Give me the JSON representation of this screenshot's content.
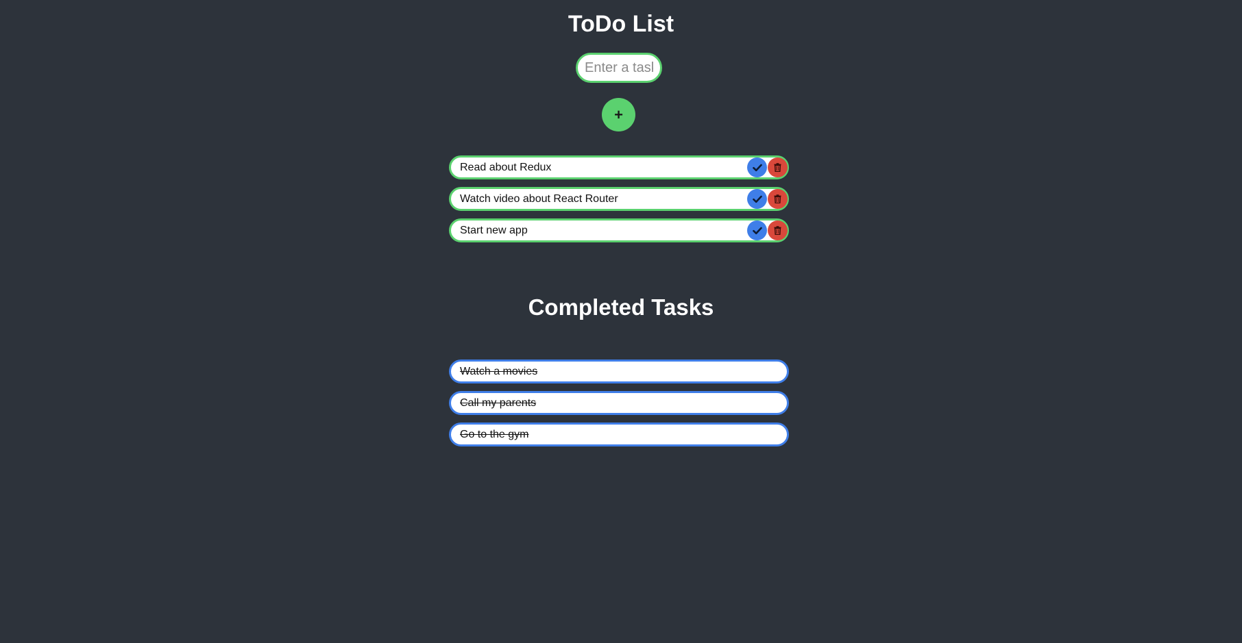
{
  "header": {
    "title": "ToDo List"
  },
  "input": {
    "placeholder": "Enter a task"
  },
  "add_button": {
    "label": "+"
  },
  "todos": [
    {
      "text": "Read about Redux"
    },
    {
      "text": "Watch video about React Router"
    },
    {
      "text": "Start new app"
    }
  ],
  "completed": {
    "title": "Completed Tasks",
    "items": [
      {
        "text": "Watch a movies"
      },
      {
        "text": "Call my parents"
      },
      {
        "text": "Go to the gym"
      }
    ]
  },
  "colors": {
    "background": "#2d333b",
    "green": "#5bd16f",
    "blue": "#3f7ee8",
    "red": "#d9483b"
  },
  "icons": {
    "complete": "check-icon",
    "delete": "trash-icon"
  }
}
